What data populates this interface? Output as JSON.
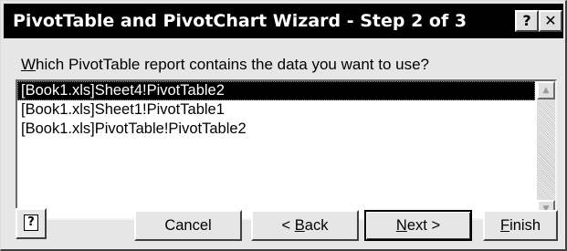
{
  "window": {
    "title": "PivotTable and PivotChart Wizard - Step 2 of 3",
    "help_glyph": "?",
    "close_glyph": "✕"
  },
  "prompt": {
    "accel": "W",
    "rest": "hich PivotTable report contains the data you want to use?"
  },
  "list": {
    "items": [
      "[Book1.xls]Sheet4!PivotTable2",
      "[Book1.xls]Sheet1!PivotTable1",
      "[Book1.xls]PivotTable!PivotTable2"
    ],
    "selected_index": 0
  },
  "scrollbar": {
    "up_icon": "▲",
    "down_icon": "▼"
  },
  "buttons": {
    "help_icon": "?",
    "cancel": "Cancel",
    "back_prefix": "< ",
    "back_accel": "B",
    "back_rest": "ack",
    "next_accel": "N",
    "next_rest": "ext >",
    "finish_accel": "F",
    "finish_rest": "inish"
  }
}
